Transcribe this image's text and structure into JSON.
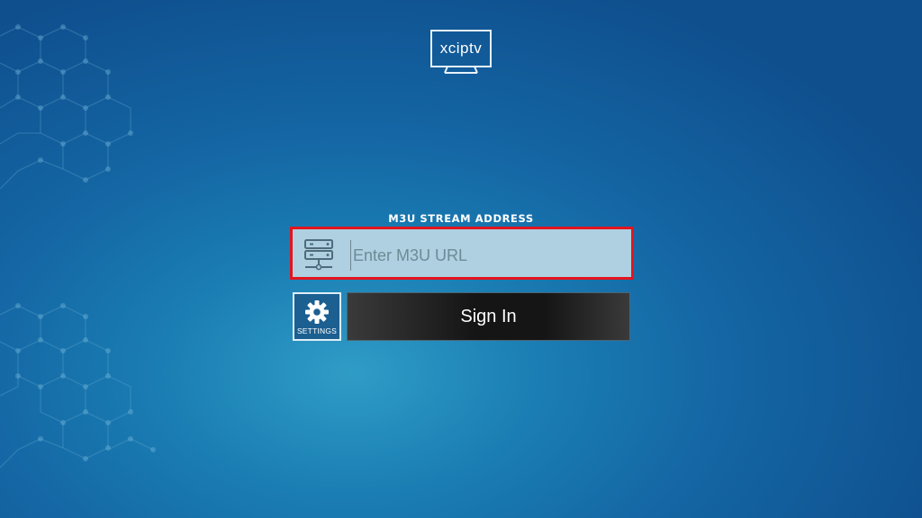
{
  "app": {
    "logo_text": "xciptv"
  },
  "login": {
    "field_label": "M3U STREAM ADDRESS",
    "url_placeholder": "Enter M3U URL",
    "url_value": ""
  },
  "buttons": {
    "settings_label": "SETTINGS",
    "signin_label": "Sign In"
  },
  "colors": {
    "accent_border": "#e3141e",
    "input_bg": "#aed0e1",
    "background_primary": "#1672ab"
  },
  "icons": {
    "server": "server-icon",
    "settings": "gear-icon",
    "logo": "tv-logo-icon"
  }
}
